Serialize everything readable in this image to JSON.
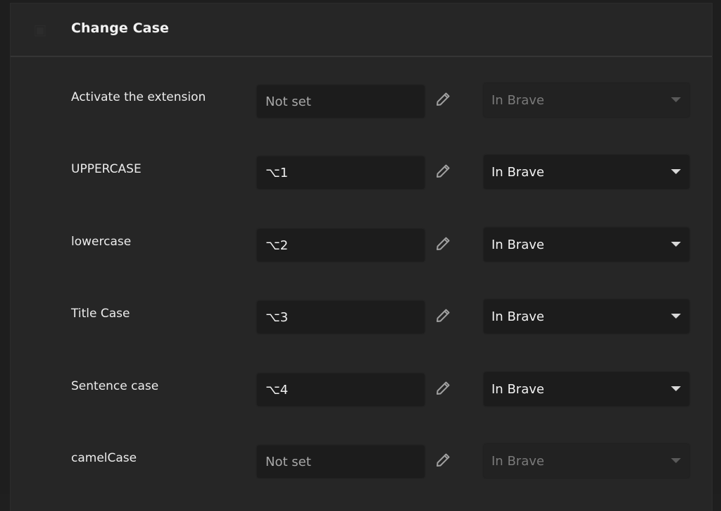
{
  "section": {
    "title": "Change Case",
    "icon": "extension-icon"
  },
  "rows": [
    {
      "label": "Activate the extension",
      "shortcut": "Not set",
      "shortcut_set": false,
      "scope": "In Brave",
      "scope_enabled": false
    },
    {
      "label": "UPPERCASE",
      "shortcut": "⌥1",
      "shortcut_set": true,
      "scope": "In Brave",
      "scope_enabled": true
    },
    {
      "label": "lowercase",
      "shortcut": "⌥2",
      "shortcut_set": true,
      "scope": "In Brave",
      "scope_enabled": true
    },
    {
      "label": "Title Case",
      "shortcut": "⌥3",
      "shortcut_set": true,
      "scope": "In Brave",
      "scope_enabled": true
    },
    {
      "label": "Sentence case",
      "shortcut": "⌥4",
      "shortcut_set": true,
      "scope": "In Brave",
      "scope_enabled": true
    },
    {
      "label": "camelCase",
      "shortcut": "Not set",
      "shortcut_set": false,
      "scope": "In Brave",
      "scope_enabled": false
    }
  ],
  "colors": {
    "background": "#262626",
    "input_bg": "#1c1c1c",
    "text": "#f2f2f2",
    "muted_text": "#a8a8a8",
    "disabled_text": "#7a7a7a"
  }
}
